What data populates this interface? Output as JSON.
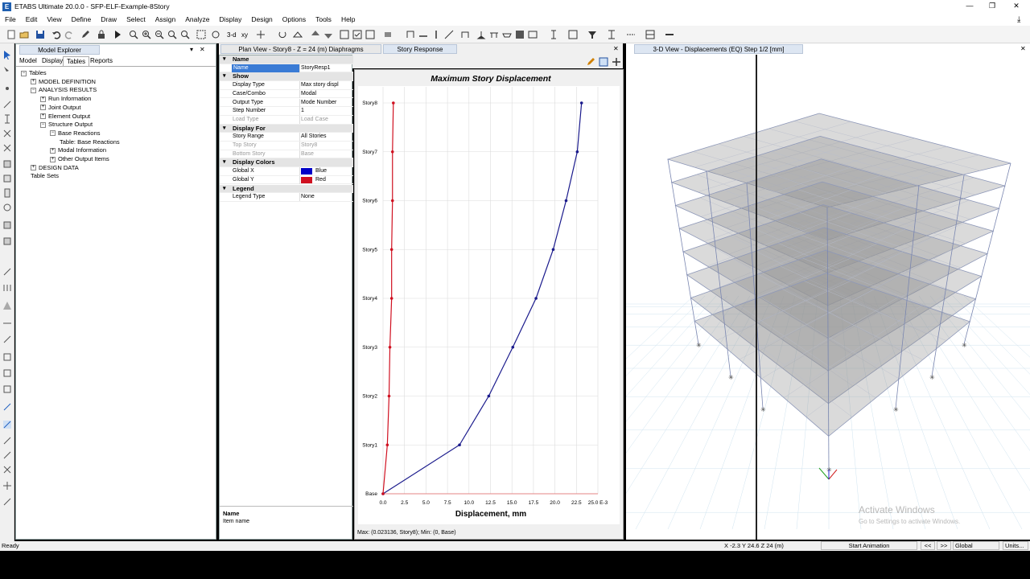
{
  "window": {
    "title": "ETABS Ultimate 20.0.0 - SFP-ELF-Example-8Story",
    "icon": "E",
    "min": "—",
    "max": "❐",
    "close": "✕"
  },
  "menu": [
    "File",
    "Edit",
    "View",
    "Define",
    "Draw",
    "Select",
    "Assign",
    "Analyze",
    "Display",
    "Design",
    "Options",
    "Tools",
    "Help"
  ],
  "toolbar": {
    "view3d_label": "3-d",
    "xy_label": "xy"
  },
  "explorer": {
    "title": "Model Explorer",
    "close": "✕",
    "pin": "▾",
    "tabs": [
      "Model",
      "Display",
      "Tables",
      "Reports"
    ],
    "tree": [
      {
        "label": "Tables",
        "indent": 0,
        "box": "−"
      },
      {
        "label": "MODEL DEFINITION",
        "indent": 1,
        "box": "+"
      },
      {
        "label": "ANALYSIS RESULTS",
        "indent": 1,
        "box": "−"
      },
      {
        "label": "Run Information",
        "indent": 2,
        "box": "+"
      },
      {
        "label": "Joint Output",
        "indent": 2,
        "box": "+"
      },
      {
        "label": "Element Output",
        "indent": 2,
        "box": "+"
      },
      {
        "label": "Structure Output",
        "indent": 2,
        "box": "−"
      },
      {
        "label": "Base Reactions",
        "indent": 3,
        "box": "−"
      },
      {
        "label": "Table:  Base Reactions",
        "indent": 4,
        "box": ""
      },
      {
        "label": "Modal Information",
        "indent": 3,
        "box": "+"
      },
      {
        "label": "Other Output Items",
        "indent": 3,
        "box": "+"
      },
      {
        "label": "DESIGN DATA",
        "indent": 1,
        "box": "+"
      },
      {
        "label": "Table Sets",
        "indent": 1,
        "box": ""
      }
    ]
  },
  "tabs_center": {
    "plan": "Plan View - Story8 - Z = 24 (m)  Diaphragms",
    "story": "Story Response",
    "close": "✕"
  },
  "props": [
    {
      "type": "sec",
      "k": "Name"
    },
    {
      "type": "sel",
      "k": "Name",
      "v": "StoryResp1"
    },
    {
      "type": "sec",
      "k": "Show"
    },
    {
      "k": "Display Type",
      "v": "Max story displ"
    },
    {
      "k": "Case/Combo",
      "v": "Modal"
    },
    {
      "k": "Output Type",
      "v": "Mode Number"
    },
    {
      "k": "Step Number",
      "v": "1"
    },
    {
      "k": "Load Type",
      "v": "Load Case",
      "dim": true
    },
    {
      "type": "sec",
      "k": "Display For"
    },
    {
      "k": "Story Range",
      "v": "All Stories"
    },
    {
      "k": "Top Story",
      "v": "Story8",
      "dim": true
    },
    {
      "k": "Bottom Story",
      "v": "Base",
      "dim": true
    },
    {
      "type": "sec",
      "k": "Display Colors"
    },
    {
      "k": "Global X",
      "v": "Blue",
      "swatch": "#0000c8"
    },
    {
      "k": "Global Y",
      "v": "Red",
      "swatch": "#d01020"
    },
    {
      "type": "sec",
      "k": "Legend"
    },
    {
      "k": "Legend Type",
      "v": "None"
    }
  ],
  "propdesc": {
    "title": "Name",
    "text": "Item name"
  },
  "chart_data": {
    "type": "line",
    "title": "Maximum Story Displacement",
    "xlabel": "Displacement, mm",
    "ylabel": "",
    "categories": [
      "Base",
      "Story1",
      "Story2",
      "Story3",
      "Story4",
      "Story5",
      "Story6",
      "Story7",
      "Story8"
    ],
    "xlim": [
      0,
      25
    ],
    "xticks": [
      "0.0",
      "2.5",
      "5.0",
      "7.5",
      "10.0",
      "12.5",
      "15.0",
      "17.5",
      "20.0",
      "22.5",
      "25.0 E-3"
    ],
    "series": [
      {
        "name": "Global X",
        "color": "#1a1a8c",
        "values": [
          0,
          8.9,
          12.3,
          15.1,
          17.8,
          19.8,
          21.3,
          22.6,
          23.1
        ]
      },
      {
        "name": "Global Y",
        "color": "#d01020",
        "values": [
          0,
          0.5,
          0.7,
          0.8,
          1.0,
          1.0,
          1.1,
          1.1,
          1.2
        ]
      }
    ],
    "grid": true,
    "footer": "Max: (0.023136, Story8);   Min: (0, Base)"
  },
  "view3d": {
    "title": "3-D View  - Displacements (EQ)  Step 1/2  [mm]",
    "close": "✕",
    "watermark1": "Activate Windows",
    "watermark2": "Go to Settings to activate Windows."
  },
  "status": {
    "left": "Ready",
    "coords": "X -2.3  Y 24.6  Z 24 (m)",
    "anim": "Start Animation",
    "prev": "<<",
    "next": ">>",
    "global": "Global",
    "units": "Units..."
  }
}
